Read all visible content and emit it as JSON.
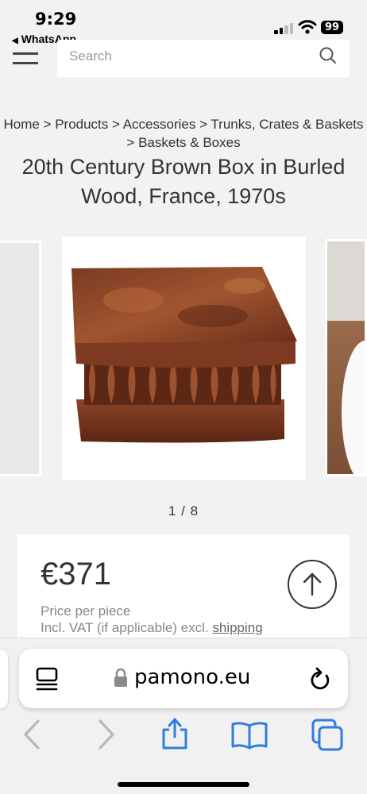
{
  "status": {
    "time": "9:29",
    "back_app": "WhatsApp",
    "battery": "99"
  },
  "search": {
    "placeholder": "Search"
  },
  "breadcrumb": "Home > Products > Accessories > Trunks, Crates & Baskets > Baskets & Boxes",
  "product": {
    "title": "20th Century Brown Box in Burled Wood, France, 1970s"
  },
  "gallery": {
    "pager": "1 / 8"
  },
  "price": {
    "amount": "€371",
    "per": "Price per piece",
    "vat": "Incl. VAT (if applicable) excl.",
    "shipping": "shipping"
  },
  "browser": {
    "url": "pamono.eu",
    "accent": "#2f7de1"
  },
  "icons": [
    "hamburger-icon",
    "search-icon",
    "arrow-up-icon",
    "reader-icon",
    "lock-icon",
    "reload-icon",
    "back-icon",
    "forward-icon",
    "share-icon",
    "bookmarks-icon",
    "tabs-icon"
  ]
}
